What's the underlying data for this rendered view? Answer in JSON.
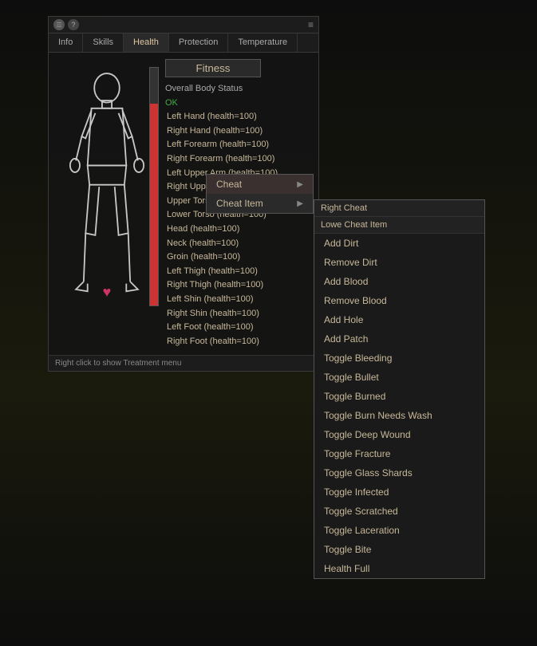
{
  "titleBar": {
    "icon": "☰",
    "helpIcon": "?",
    "filterIcon": "≡"
  },
  "tabs": [
    {
      "label": "Info",
      "active": false
    },
    {
      "label": "Skills",
      "active": false
    },
    {
      "label": "Health",
      "active": true
    },
    {
      "label": "Protection",
      "active": false
    },
    {
      "label": "Temperature",
      "active": false
    }
  ],
  "fitnessButton": "Fitness",
  "bodyStatus": {
    "label": "Overall Body Status",
    "value": "OK"
  },
  "bodyParts": [
    "Left Hand (health=100)",
    "Right Hand (health=100)",
    "Left Forearm (health=100)",
    "Right Forearm (health=100)",
    "Left Upper Arm (health=100)",
    "Right Upper Arm (health=100)",
    "Upper Torso (health=100)",
    "Lower Torso (health=100)",
    "Head (health=100)",
    "Neck (health=100)",
    "Groin (health=100)",
    "Left Thigh (health=100)",
    "Right Thigh (health=100)",
    "Left Shin (health=100)",
    "Right Shin (health=100)",
    "Left Foot (health=100)",
    "Right Foot (health=100)"
  ],
  "footerText": "Right click to show Treatment menu",
  "contextMenu": {
    "items": [
      {
        "label": "Cheat",
        "hasArrow": true
      },
      {
        "label": "Cheat Item",
        "hasArrow": true
      }
    ]
  },
  "cheatItemMenu": {
    "header": "Right Cheat",
    "subHeader": "Lowe Cheat Item",
    "options": [
      "Add Dirt",
      "Remove Dirt",
      "Add Blood",
      "Remove Blood",
      "Add Hole",
      "Add Patch",
      "Toggle Bleeding",
      "Toggle Bullet",
      "Toggle Burned",
      "Toggle Burn Needs Wash",
      "Toggle Deep Wound",
      "Toggle Fracture",
      "Toggle Glass Shards",
      "Toggle Infected",
      "Toggle Scratched",
      "Toggle Laceration",
      "Toggle Bite",
      "Health Full"
    ]
  }
}
